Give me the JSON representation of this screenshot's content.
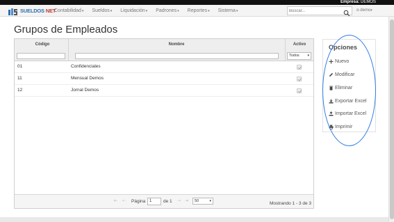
{
  "topbar": {
    "empresa_label": "Empresa:",
    "empresa_value": "DEMOS"
  },
  "brand": {
    "name_main": "SUELDOS",
    "name_suffix": "NET"
  },
  "nav": {
    "items": [
      {
        "label": "Contabilidad"
      },
      {
        "label": "Sueldos"
      },
      {
        "label": "Liquidación"
      },
      {
        "label": "Padrones"
      },
      {
        "label": "Reportes"
      },
      {
        "label": "Sistema"
      }
    ],
    "search_placeholder": "Buscar...",
    "user": "demo"
  },
  "page": {
    "title": "Grupos de Empleados"
  },
  "grid": {
    "columns": {
      "codigo": "Código",
      "nombre": "Nombre",
      "activo": "Activo"
    },
    "activo_filter": "Todos",
    "rows": [
      {
        "codigo": "01",
        "nombre": "Confidenciales",
        "activo": true
      },
      {
        "codigo": "11",
        "nombre": "Mensual Demos",
        "activo": true
      },
      {
        "codigo": "12",
        "nombre": "Jornal Demos",
        "activo": true
      }
    ],
    "pager": {
      "page_label": "Página",
      "page_value": "1",
      "of_label": "de 1",
      "page_size": "50",
      "info": "Mostrando 1 - 3 de 3"
    }
  },
  "opciones": {
    "title": "Opciones",
    "items": [
      {
        "label": "Nuevo",
        "icon": "plus-icon"
      },
      {
        "label": "Modificar",
        "icon": "pencil-icon"
      },
      {
        "label": "Eliminar",
        "icon": "trash-icon"
      },
      {
        "label": "Exportar Excel",
        "icon": "download-icon"
      },
      {
        "label": "Importar Excel",
        "icon": "upload-icon"
      },
      {
        "label": "Imprimir",
        "icon": "print-icon"
      }
    ]
  },
  "colors": {
    "brand_blue": "#2d6fb0",
    "brand_red": "#c0392b",
    "annotation": "#2e7be2"
  }
}
